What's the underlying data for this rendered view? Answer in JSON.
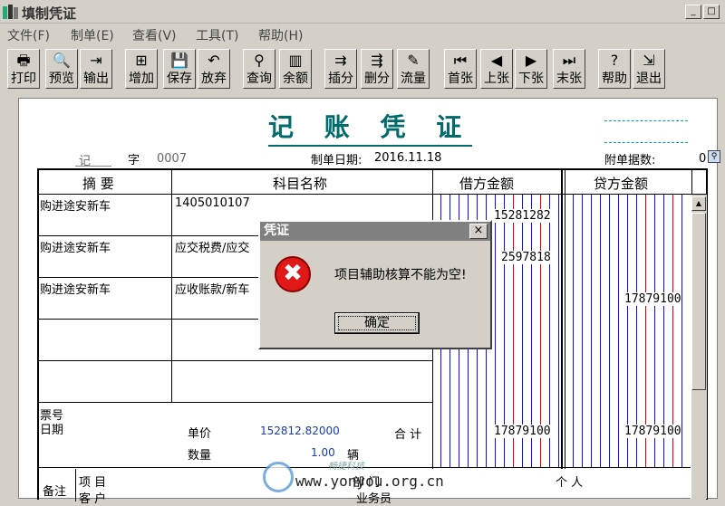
{
  "window": {
    "title": "填制凭证",
    "min": "_",
    "max": "□"
  },
  "menu": [
    "文件(F)",
    "制单(E)",
    "查看(V)",
    "工具(T)",
    "帮助(H)"
  ],
  "toolbar": [
    {
      "label": "打印",
      "icon": "printer-icon",
      "glyph": "🖶"
    },
    {
      "label": "预览",
      "icon": "preview-icon",
      "glyph": "🔍"
    },
    {
      "label": "输出",
      "icon": "export-icon",
      "glyph": "⇥"
    },
    {
      "label": "增加",
      "icon": "add-icon",
      "glyph": "⊞"
    },
    {
      "label": "保存",
      "icon": "save-icon",
      "glyph": "💾"
    },
    {
      "label": "放弃",
      "icon": "undo-icon",
      "glyph": "↶"
    },
    {
      "label": "查询",
      "icon": "binoculars-icon",
      "glyph": "⚲"
    },
    {
      "label": "余额",
      "icon": "balance-chart-icon",
      "glyph": "▥"
    },
    {
      "label": "插分",
      "icon": "insert-entry-icon",
      "glyph": "⇉"
    },
    {
      "label": "删分",
      "icon": "delete-entry-icon",
      "glyph": "⇶"
    },
    {
      "label": "流量",
      "icon": "flow-icon",
      "glyph": "✎"
    },
    {
      "label": "首张",
      "icon": "first-icon",
      "glyph": "⏮"
    },
    {
      "label": "上张",
      "icon": "prev-icon",
      "glyph": "◀"
    },
    {
      "label": "下张",
      "icon": "next-icon",
      "glyph": "▶"
    },
    {
      "label": "末张",
      "icon": "last-icon",
      "glyph": "⏭"
    },
    {
      "label": "帮助",
      "icon": "help-icon",
      "glyph": "?"
    },
    {
      "label": "退出",
      "icon": "exit-icon",
      "glyph": "⇲"
    }
  ],
  "voucher": {
    "title": "记 账 凭 证",
    "type_label": "记",
    "zi": "字",
    "number": "0007",
    "date_label": "制单日期:",
    "date": "2016.11.18",
    "attach_label": "附单据数:",
    "attach_count": "0",
    "headers": {
      "summary": "摘 要",
      "account": "科目名称",
      "debit": "借方金额",
      "credit": "贷方金额"
    },
    "rows": [
      {
        "summary": "购进途安新车",
        "account": "1405010107",
        "debit": "15281282",
        "credit": ""
      },
      {
        "summary": "购进途安新车",
        "account": "应交税费/应交",
        "debit": "2597818",
        "credit": ""
      },
      {
        "summary": "购进途安新车",
        "account": "应收账款/新车",
        "debit": "",
        "credit": "17879100"
      },
      {
        "summary": "",
        "account": "",
        "debit": "",
        "credit": ""
      },
      {
        "summary": "",
        "account": "",
        "debit": "",
        "credit": ""
      }
    ],
    "footer": {
      "ticket_no": "票号",
      "date": "日期",
      "unit_price_label": "单价",
      "unit_price": "152812.82000",
      "qty_label": "数量",
      "qty": "1.00",
      "unit": "辆",
      "total_label": "合 计",
      "total_debit": "17879100",
      "total_credit": "17879100"
    },
    "remark": {
      "label": "备注",
      "project": "项  目",
      "customer": "客  户",
      "dept": "部 门",
      "person": "个 人",
      "biz": "业务员"
    }
  },
  "dialog": {
    "title": "凭证",
    "close": "×",
    "icon": "error-icon",
    "glyph": "✖",
    "message": "项目辅助核算不能为空!",
    "ok": "确定"
  },
  "watermark": {
    "text": "www.yonyou.org.cn",
    "sub": "畅捷科技"
  }
}
